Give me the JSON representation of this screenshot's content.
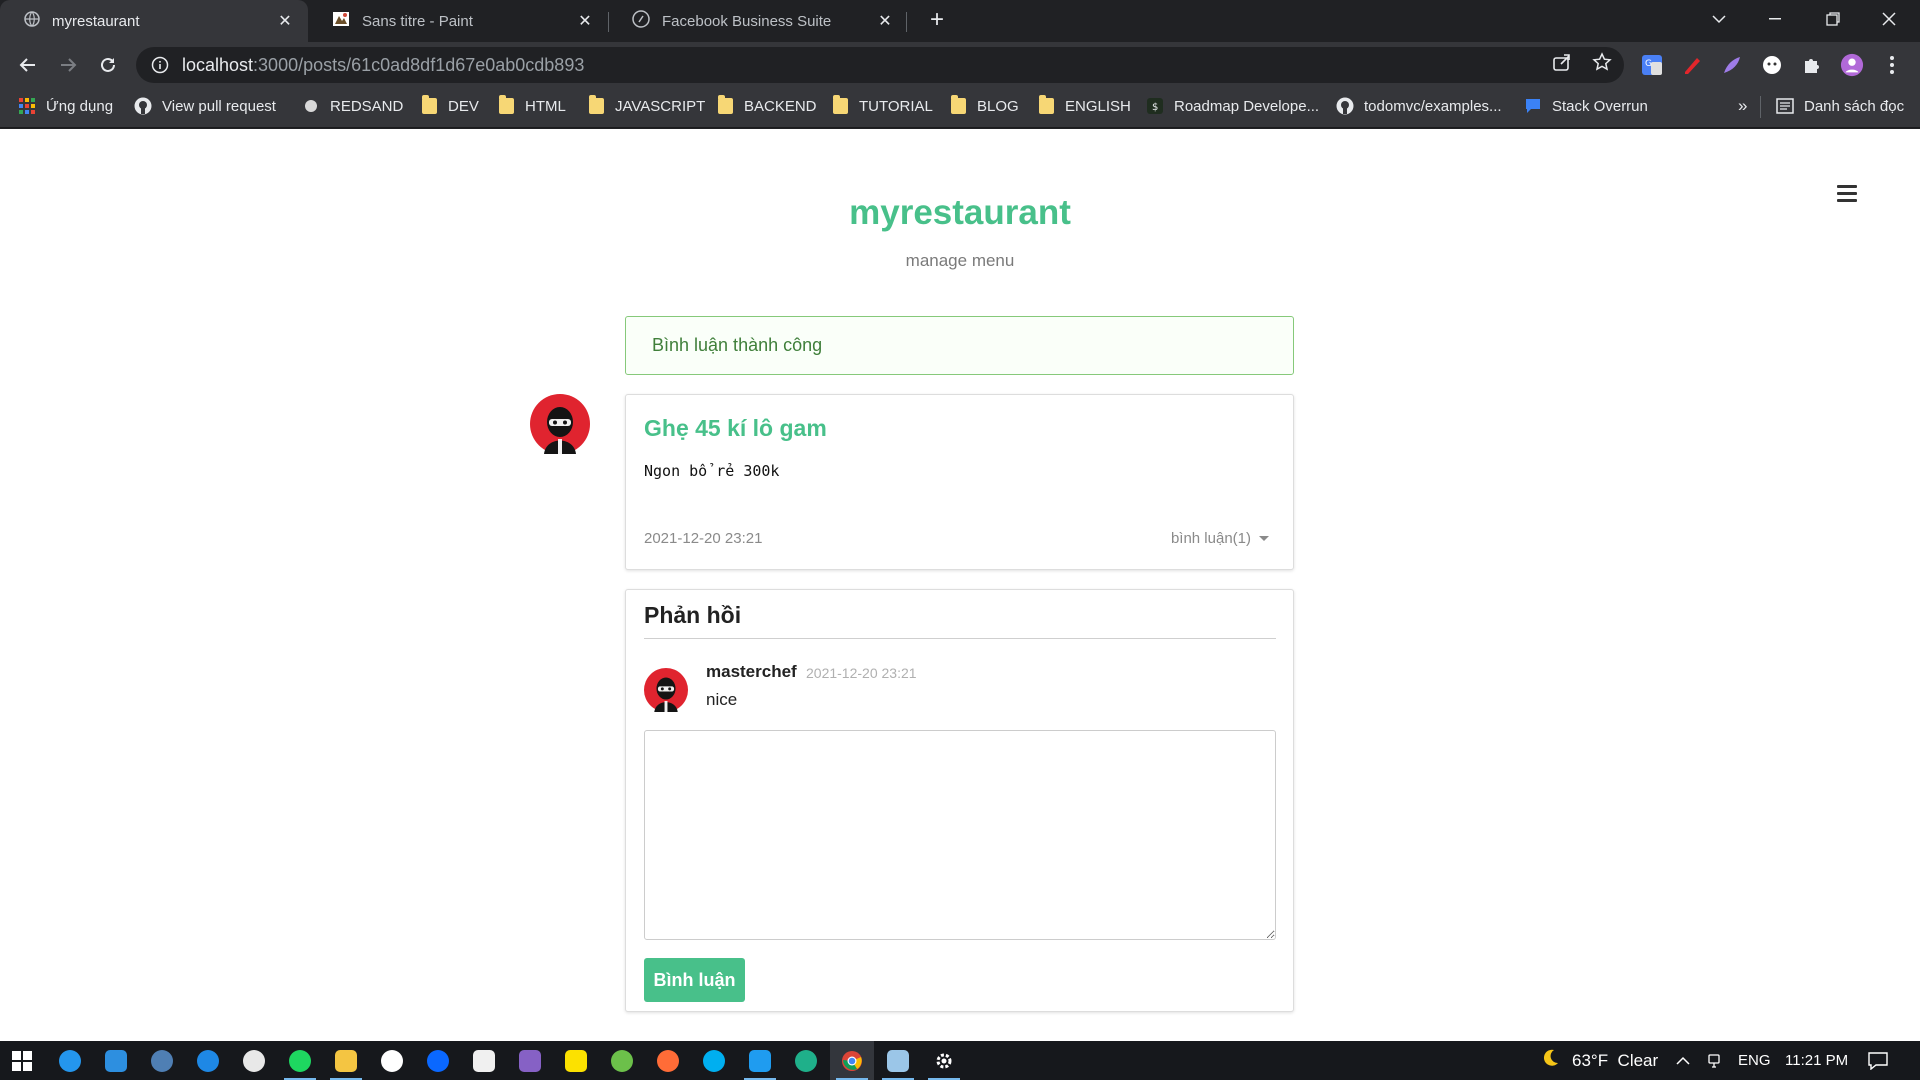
{
  "browser": {
    "tabs": [
      {
        "title": "myrestaurant",
        "active": true,
        "icon": "globe-icon"
      },
      {
        "title": "Sans titre - Paint",
        "active": false,
        "icon": "paint-icon"
      },
      {
        "title": "Facebook Business Suite",
        "active": false,
        "icon": "facebook-icon"
      }
    ],
    "close_glyph": "✕",
    "new_tab_glyph": "+",
    "address": {
      "host": "localhost",
      "path": ":3000/posts/61c0ad8df1d67e0ab0cdb893"
    },
    "bookmarks": [
      {
        "label": "Ứng dụng",
        "icon": "apps-grid-icon"
      },
      {
        "label": "View pull request",
        "icon": "github-icon"
      },
      {
        "label": "REDSAND",
        "icon": "circle-icon"
      },
      {
        "label": "DEV",
        "icon": "folder-icon"
      },
      {
        "label": "HTML",
        "icon": "folder-icon"
      },
      {
        "label": "JAVASCRIPT",
        "icon": "folder-icon"
      },
      {
        "label": "BACKEND",
        "icon": "folder-icon"
      },
      {
        "label": "TUTORIAL",
        "icon": "folder-icon"
      },
      {
        "label": "BLOG",
        "icon": "folder-icon"
      },
      {
        "label": "ENGLISH",
        "icon": "folder-icon"
      },
      {
        "label": "Roadmap Develope...",
        "icon": "roadmap-icon"
      },
      {
        "label": "todomvc/examples...",
        "icon": "github-icon"
      },
      {
        "label": "Stack Overrun",
        "icon": "stack-icon"
      }
    ],
    "overflow_glyph": "»",
    "reading_list": "Danh sách đọc"
  },
  "site": {
    "brand": "myrestaurant",
    "tagline": "manage menu"
  },
  "alert": {
    "message": "Bình luận thành công"
  },
  "post": {
    "title": "Ghẹ 45 kí lô gam",
    "body": "Ngon bổ rẻ 300k",
    "date": "2021-12-20 23:21",
    "comments_label": "bình luận(1)"
  },
  "replies": {
    "heading": "Phản hồi",
    "items": [
      {
        "author": "masterchef",
        "time": "2021-12-20 23:21",
        "text": "nice"
      }
    ],
    "textarea_placeholder": "",
    "submit_label": "Bình luận"
  },
  "taskbar": {
    "weather": "63°F  Clear",
    "language": "ENG",
    "time": "11:21 PM"
  },
  "colors": {
    "brand_green": "#48c08a",
    "alert_border": "#86c97a",
    "avatar_red": "#e0242f"
  }
}
